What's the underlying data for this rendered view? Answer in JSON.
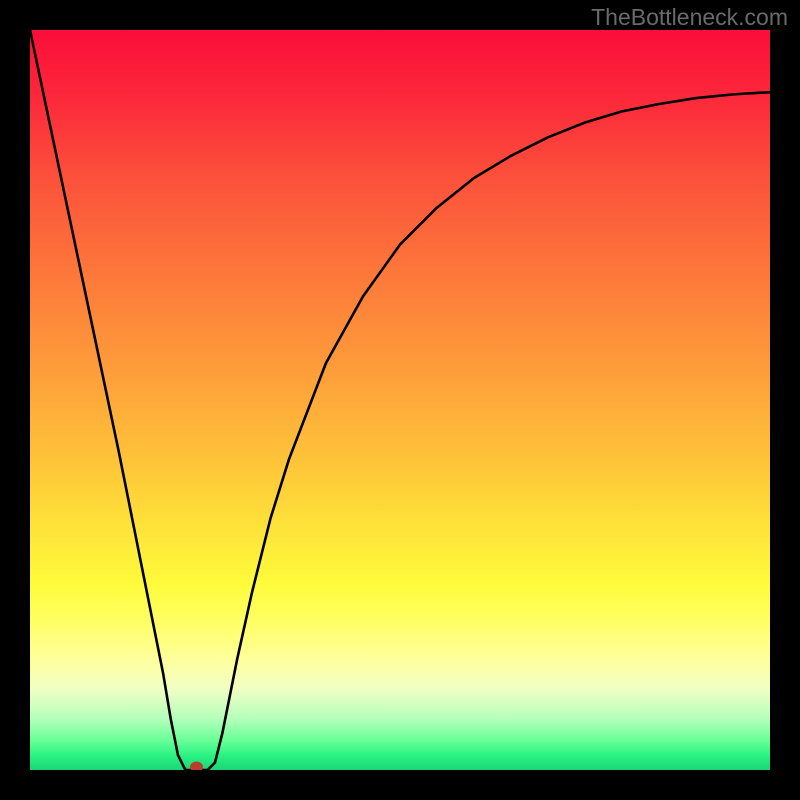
{
  "watermark": "TheBottleneck.com",
  "colors": {
    "frame": "#000000",
    "curve_stroke": "#000000",
    "marker_fill": "#b8402a",
    "gradient_stops": [
      "#fb0d3a",
      "#fd753a",
      "#fee239",
      "#ffff65",
      "#19d578"
    ]
  },
  "chart_data": {
    "type": "line",
    "title": "",
    "xlabel": "",
    "ylabel": "",
    "xlim": [
      0,
      100
    ],
    "ylim": [
      0,
      100
    ],
    "grid": false,
    "legend": false,
    "annotations": [
      "TheBottleneck.com"
    ],
    "x": [
      0,
      4,
      8,
      12,
      16,
      18,
      19,
      20,
      21,
      22,
      23,
      24,
      25,
      26,
      28,
      30,
      32.5,
      35,
      40,
      45,
      50,
      55,
      60,
      65,
      70,
      75,
      80,
      85,
      90,
      95,
      100
    ],
    "y": [
      100,
      81,
      62,
      43,
      23,
      13,
      7,
      2,
      0,
      0,
      0,
      0,
      1,
      5,
      15,
      24,
      34,
      42,
      55,
      64,
      71,
      76,
      80,
      83,
      85.5,
      87.5,
      89,
      90,
      90.8,
      91.3,
      91.6
    ],
    "marker_point": {
      "x": 22.5,
      "y": 0
    }
  }
}
